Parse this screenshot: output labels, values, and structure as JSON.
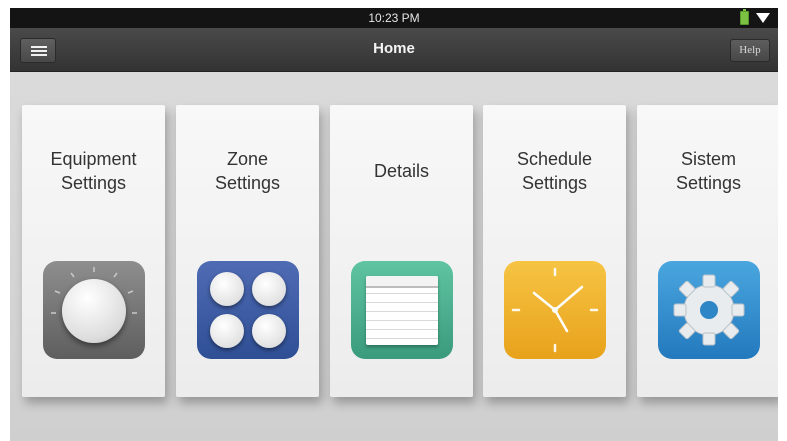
{
  "status_bar": {
    "time": "10:23 PM"
  },
  "app_bar": {
    "title": "Home",
    "help_label": "Help"
  },
  "cards": [
    {
      "label": "Equipment\nSettings",
      "icon": "knob-icon"
    },
    {
      "label": "Zone\nSettings",
      "icon": "zone-buttons-icon"
    },
    {
      "label": "Details",
      "icon": "notepad-icon"
    },
    {
      "label": "Schedule\nSettings",
      "icon": "clock-icon"
    },
    {
      "label": "Sistem\nSettings",
      "icon": "gear-icon"
    }
  ],
  "colors": {
    "app_bar": "#3c3c3c",
    "zone_icon": "#3d5aa6",
    "details_icon": "#4db191",
    "schedule_icon": "#f0b22e",
    "system_icon": "#3190d0"
  }
}
